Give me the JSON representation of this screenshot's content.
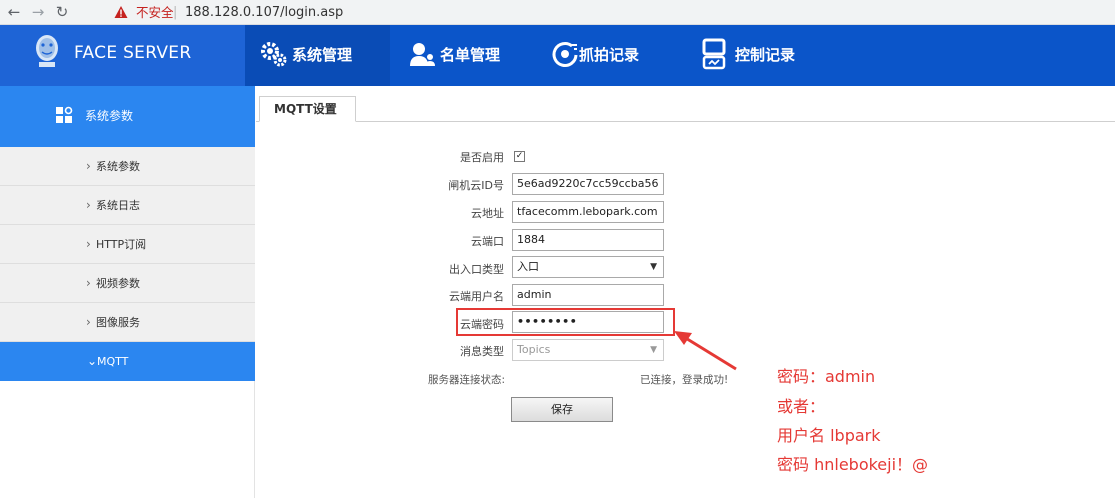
{
  "browser": {
    "insecure_label": "不安全",
    "separator": "|",
    "url": "188.128.0.107/login.asp"
  },
  "brand": {
    "name": "FACE SERVER"
  },
  "menu": [
    {
      "label": "系统管理",
      "icon": "gears-icon"
    },
    {
      "label": "名单管理",
      "icon": "users-icon"
    },
    {
      "label": "抓拍记录",
      "icon": "camera-capture-icon"
    },
    {
      "label": "控制记录",
      "icon": "monitor-icon"
    }
  ],
  "sidebar": {
    "header": "系统参数",
    "items": [
      {
        "label": "系统参数"
      },
      {
        "label": "系统日志"
      },
      {
        "label": "HTTP订阅"
      },
      {
        "label": "视频参数"
      },
      {
        "label": "图像服务"
      },
      {
        "label": "MQTT"
      }
    ]
  },
  "tab": {
    "label": "MQTT设置"
  },
  "form": {
    "enabled_label": "是否启用",
    "enabled_checked": true,
    "cloud_id_label": "闸机云ID号",
    "cloud_id_value": "5e6ad9220c7cc59ccba56",
    "cloud_addr_label": "云地址",
    "cloud_addr_value": "tfacecomm.lebopark.com",
    "cloud_port_label": "云端口",
    "cloud_port_value": "1884",
    "entry_type_label": "出入口类型",
    "entry_type_value": "入口",
    "username_label": "云端用户名",
    "username_value": "admin",
    "password_label": "云端密码",
    "password_value": "••••••••",
    "msg_type_label": "消息类型",
    "msg_type_value": "Topics",
    "status_label": "服务器连接状态:",
    "status_value": "已连接，登录成功!",
    "save_label": "保存"
  },
  "annotation": {
    "line1": "密码：admin",
    "line2": "或者：",
    "line3": "用户名 lbpark",
    "line4": "密码 hnlebokeji！@",
    "color": "#e53935"
  }
}
